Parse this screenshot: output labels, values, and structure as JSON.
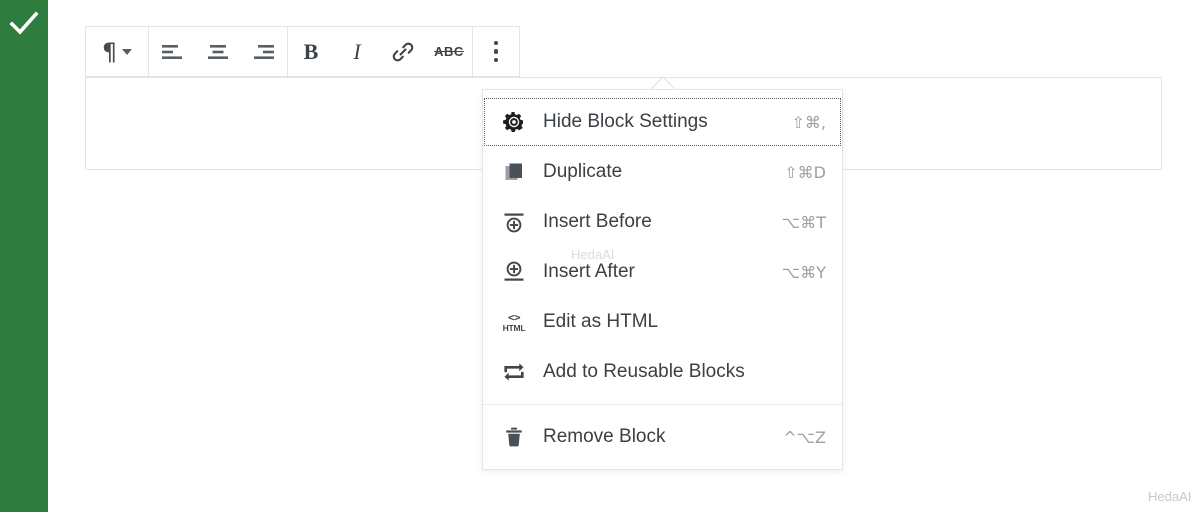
{
  "sidebar": {
    "icon": "check-icon",
    "color": "#2e7d3e"
  },
  "toolbar": {
    "groups": [
      {
        "buttons": [
          {
            "name": "paragraph-block-type",
            "icon": "pilcrow-icon",
            "glyph": "¶",
            "has_caret": true
          }
        ]
      },
      {
        "buttons": [
          {
            "name": "align-left",
            "icon": "align-left-icon"
          },
          {
            "name": "align-center",
            "icon": "align-center-icon"
          },
          {
            "name": "align-right",
            "icon": "align-right-icon"
          }
        ]
      },
      {
        "buttons": [
          {
            "name": "bold",
            "icon": "bold-icon",
            "glyph": "B"
          },
          {
            "name": "italic",
            "icon": "italic-icon",
            "glyph": "I"
          },
          {
            "name": "link",
            "icon": "link-icon"
          },
          {
            "name": "strikethrough",
            "icon": "strikethrough-icon",
            "glyph": "ABC"
          }
        ]
      },
      {
        "buttons": [
          {
            "name": "more-options",
            "icon": "vertical-ellipsis-icon"
          }
        ]
      }
    ]
  },
  "menu": {
    "sections": [
      {
        "items": [
          {
            "label": "Hide Block Settings",
            "shortcut": "⇧⌘,",
            "icon": "gear-icon",
            "focused": true
          },
          {
            "label": "Duplicate",
            "shortcut": "⇧⌘D",
            "icon": "duplicate-icon",
            "focused": false
          },
          {
            "label": "Insert Before",
            "shortcut": "⌥⌘T",
            "icon": "insert-before-icon",
            "focused": false
          },
          {
            "label": "Insert After",
            "shortcut": "⌥⌘Y",
            "icon": "insert-after-icon",
            "focused": false
          },
          {
            "label": "Edit as HTML",
            "shortcut": "",
            "icon": "html-icon",
            "focused": false
          },
          {
            "label": "Add to Reusable Blocks",
            "shortcut": "",
            "icon": "reusable-blocks-icon",
            "focused": false
          }
        ]
      },
      {
        "items": [
          {
            "label": "Remove Block",
            "shortcut": "^⌥Z",
            "icon": "trash-icon",
            "focused": false
          }
        ]
      }
    ]
  },
  "watermarks": {
    "inner": "HedaAI",
    "corner": "HedaAI"
  },
  "content": {
    "text": ""
  }
}
